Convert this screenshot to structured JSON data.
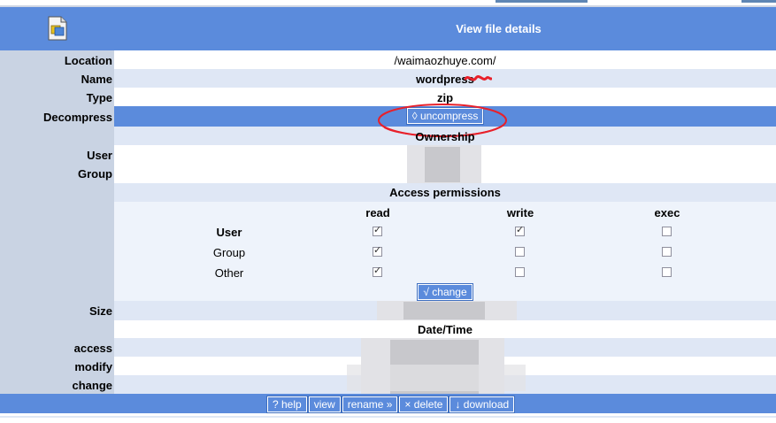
{
  "header": {
    "title": "View file details",
    "icon": "zip-file-icon"
  },
  "labels": {
    "location": "Location",
    "name": "Name",
    "type": "Type",
    "decompress": "Decompress",
    "user": "User",
    "group": "Group",
    "size": "Size",
    "access": "access",
    "modify": "modify",
    "change": "change"
  },
  "details": {
    "location": "/waimaozhuye.com/",
    "name": "wordpress",
    "type": "zip",
    "uncompress_button": "◊ uncompress"
  },
  "sections": {
    "ownership": "Ownership",
    "access_permissions": "Access permissions",
    "date_time": "Date/Time"
  },
  "permissions": {
    "columns": [
      "read",
      "write",
      "exec"
    ],
    "rows": [
      {
        "label": "User",
        "bold": true,
        "read": true,
        "write": true,
        "exec": false
      },
      {
        "label": "Group",
        "bold": false,
        "read": true,
        "write": false,
        "exec": false
      },
      {
        "label": "Other",
        "bold": false,
        "read": true,
        "write": false,
        "exec": false
      }
    ],
    "change_button": "√ change"
  },
  "footer": {
    "help": "? help",
    "view": "view",
    "rename": "rename »",
    "delete": "× delete",
    "download": "↓ download"
  },
  "colors": {
    "accent": "#5b8bdc",
    "label_bg": "#c9d3e3",
    "row_light": "#dfe7f5",
    "annotation": "#e8202a"
  }
}
